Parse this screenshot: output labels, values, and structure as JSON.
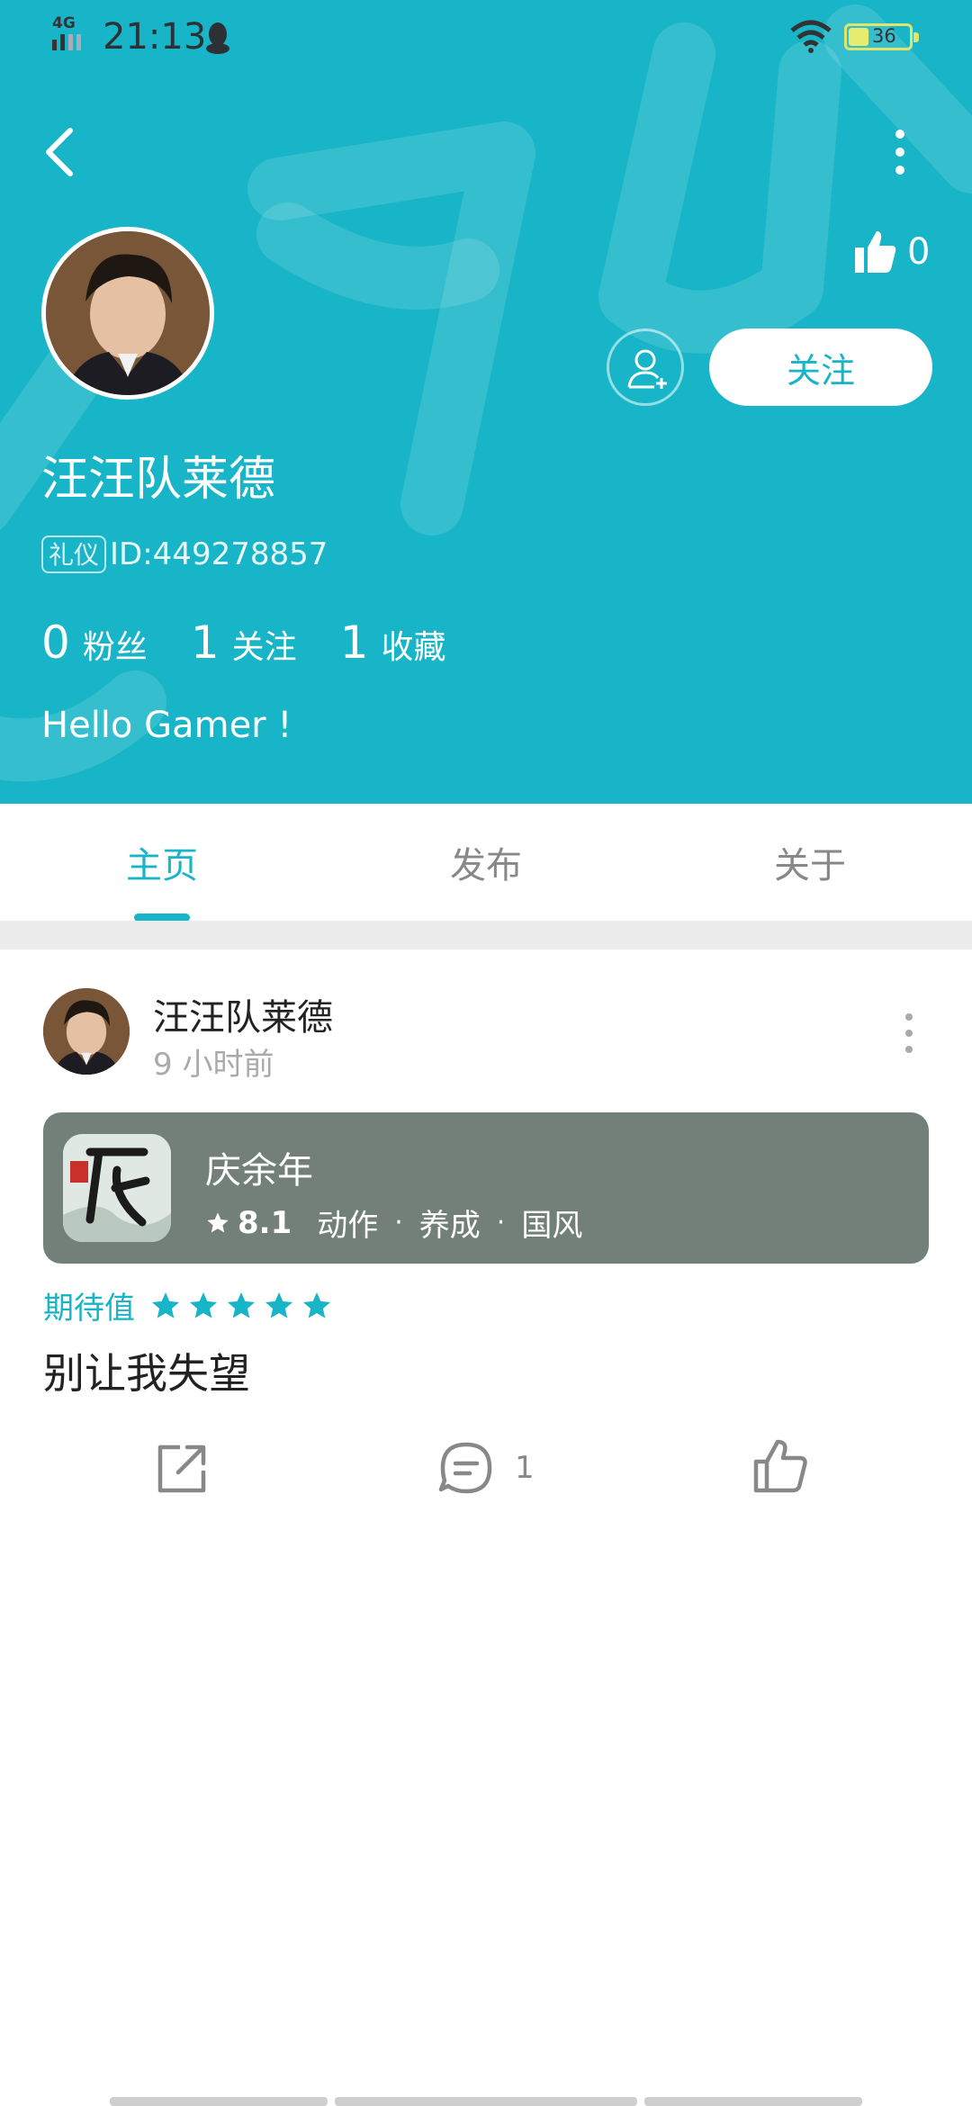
{
  "status_bar": {
    "network": "4G",
    "time": "21:13",
    "battery": "36"
  },
  "profile": {
    "likes_count": "0",
    "follow_label": "关注",
    "username": "汪汪队莱德",
    "id_tag": "礼仪",
    "id_text": "ID:449278857",
    "stats": [
      {
        "num": "0",
        "label": "粉丝"
      },
      {
        "num": "1",
        "label": "关注"
      },
      {
        "num": "1",
        "label": "收藏"
      }
    ],
    "bio": "Hello Gamer !"
  },
  "tabs": [
    {
      "label": "主页",
      "active": true
    },
    {
      "label": "发布",
      "active": false
    },
    {
      "label": "关于",
      "active": false
    }
  ],
  "post": {
    "author": "汪汪队莱德",
    "time": "9 小时前",
    "game": {
      "name": "庆余年",
      "rating": "8.1",
      "tags": [
        "动作",
        "养成",
        "国风"
      ],
      "dot": "·"
    },
    "expect_label": "期待值",
    "expect_stars": 5,
    "text": "别让我失望",
    "comment_count": "1"
  },
  "colors": {
    "accent": "#17b5c7",
    "game_card": "#738079"
  }
}
